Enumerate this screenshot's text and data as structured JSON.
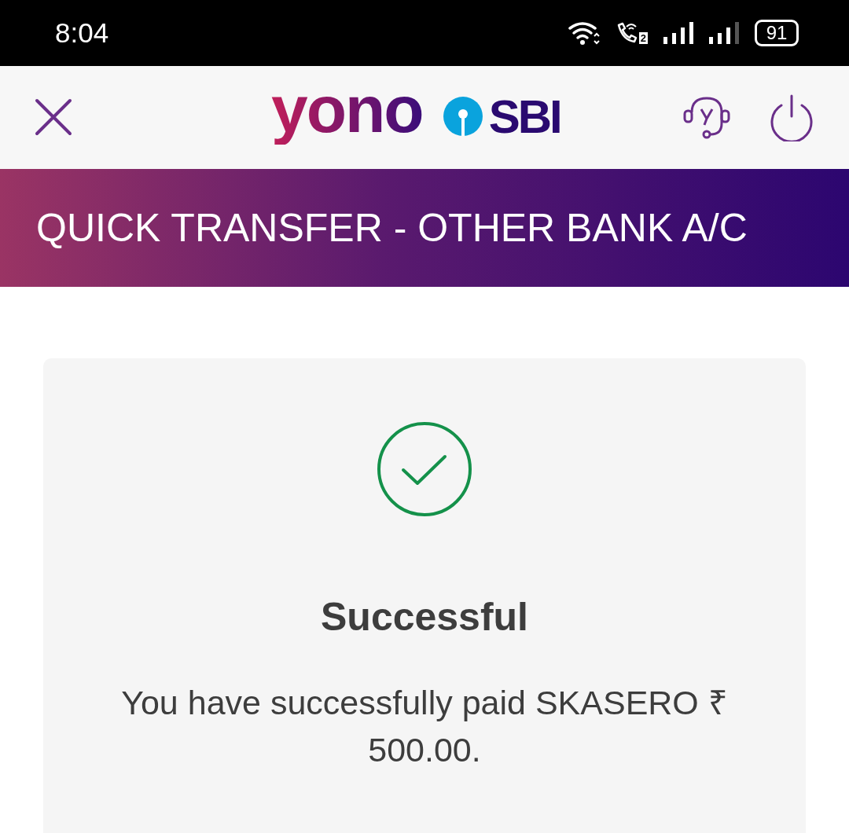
{
  "status_bar": {
    "time": "8:04",
    "battery": "91",
    "sim_badge": "2"
  },
  "header": {
    "logo_word": "yono",
    "bank_name": "SBI"
  },
  "banner": {
    "title": "QUICK TRANSFER - OTHER BANK A/C"
  },
  "result": {
    "successful": true,
    "title": "Successful",
    "message": "You have successfully paid SKASERO ₹ 500.00."
  }
}
